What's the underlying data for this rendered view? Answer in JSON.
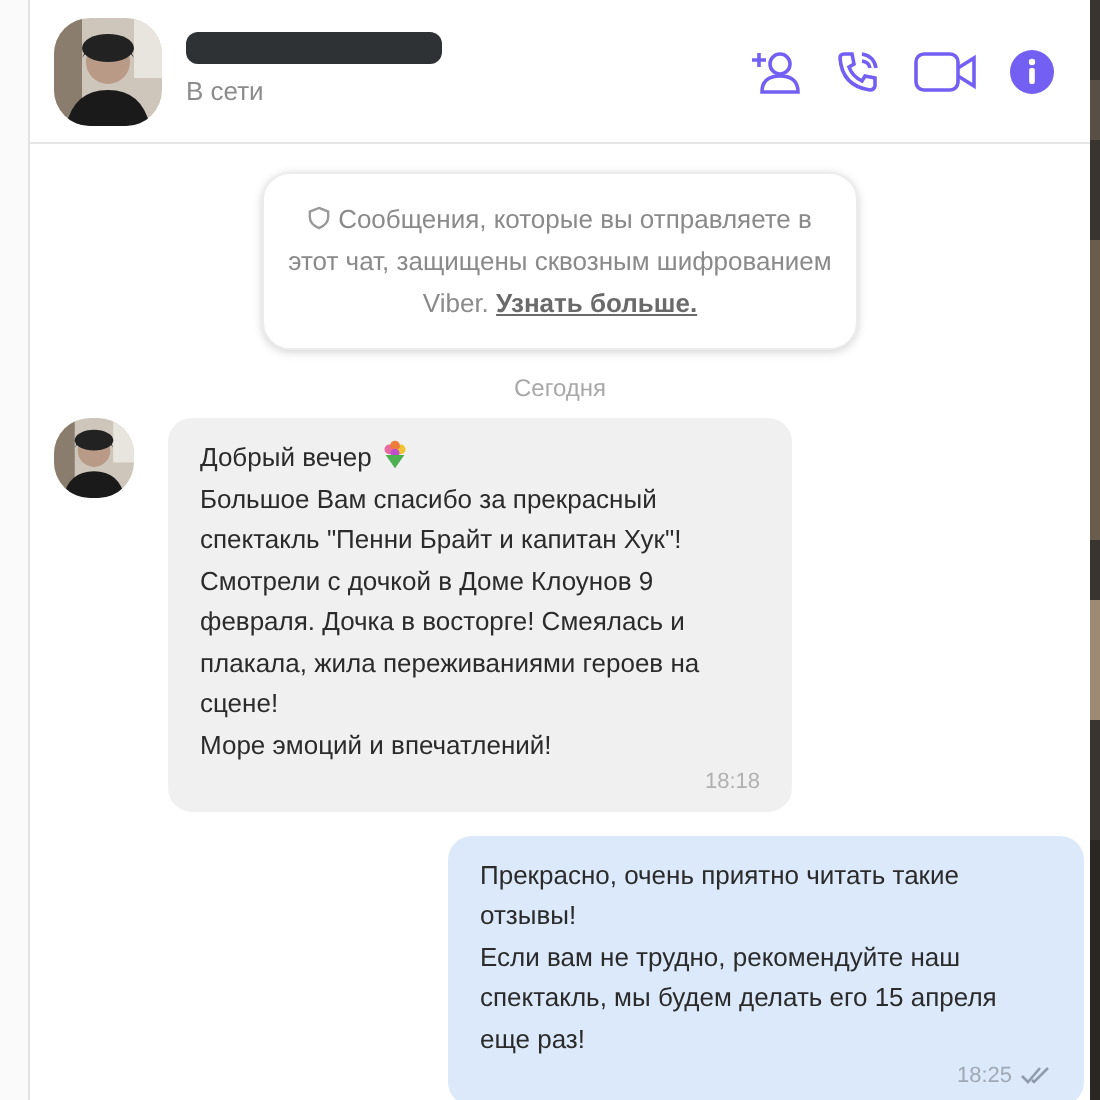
{
  "header": {
    "status": "В сети",
    "name_redacted": true
  },
  "notice": {
    "text": "Сообщения, которые вы отправляете в этот чат, защищены сквозным шифрованием Viber.",
    "link": "Узнать больше."
  },
  "date_divider": "Сегодня",
  "messages": [
    {
      "kind": "incoming",
      "lines": [
        "Добрый вечер",
        "Большое Вам спасибо за прекрасный",
        "спектакль \"Пенни Брайт и капитан Хук\"!",
        "Смотрели с дочкой в Доме Клоунов 9",
        "февраля. Дочка в восторге! Смеялась и",
        "плакала, жила переживаниями героев на",
        "сцене!",
        "Море эмоций и впечатлений!"
      ],
      "bouquet_emoji": true,
      "time": "18:18"
    },
    {
      "kind": "outgoing",
      "lines": [
        "Прекрасно, очень приятно читать такие",
        "отзывы!",
        "Если вам не трудно, рекомендуйте наш",
        "спектакль, мы будем делать его 15 апреля",
        "еще раз!"
      ],
      "time": "18:25",
      "read": true
    }
  ]
}
